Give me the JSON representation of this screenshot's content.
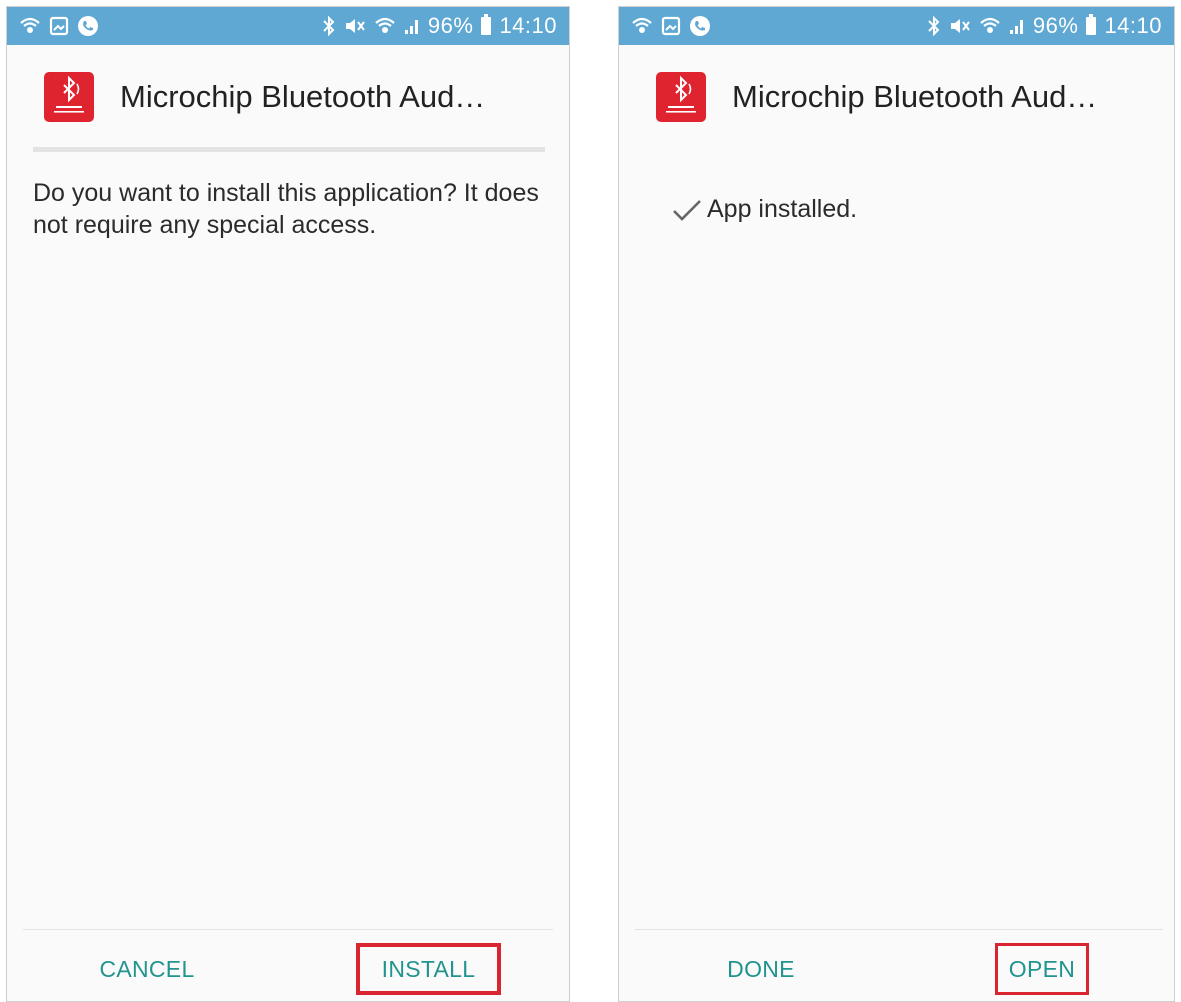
{
  "colors": {
    "status_bar": "#5ea8d3",
    "accent": "#22948e",
    "highlight": "#d9252f",
    "app_icon": "#e0242f"
  },
  "status_bar": {
    "left_icons": [
      "wifi-call-icon",
      "gallery-icon",
      "phone-icon"
    ],
    "right_icons": [
      "bluetooth-icon",
      "mute-icon",
      "wifi-icon",
      "signal-icon",
      "battery-icon"
    ],
    "battery": "96%",
    "time": "14:10"
  },
  "screens": [
    {
      "app_title": "Microchip Bluetooth Aud…",
      "message": "Do you want to install this application? It does not require any special access.",
      "buttons": {
        "left": "CANCEL",
        "right": "INSTALL"
      }
    },
    {
      "app_title": "Microchip Bluetooth Aud…",
      "message": "App installed.",
      "buttons": {
        "left": "DONE",
        "right": "OPEN"
      }
    }
  ]
}
